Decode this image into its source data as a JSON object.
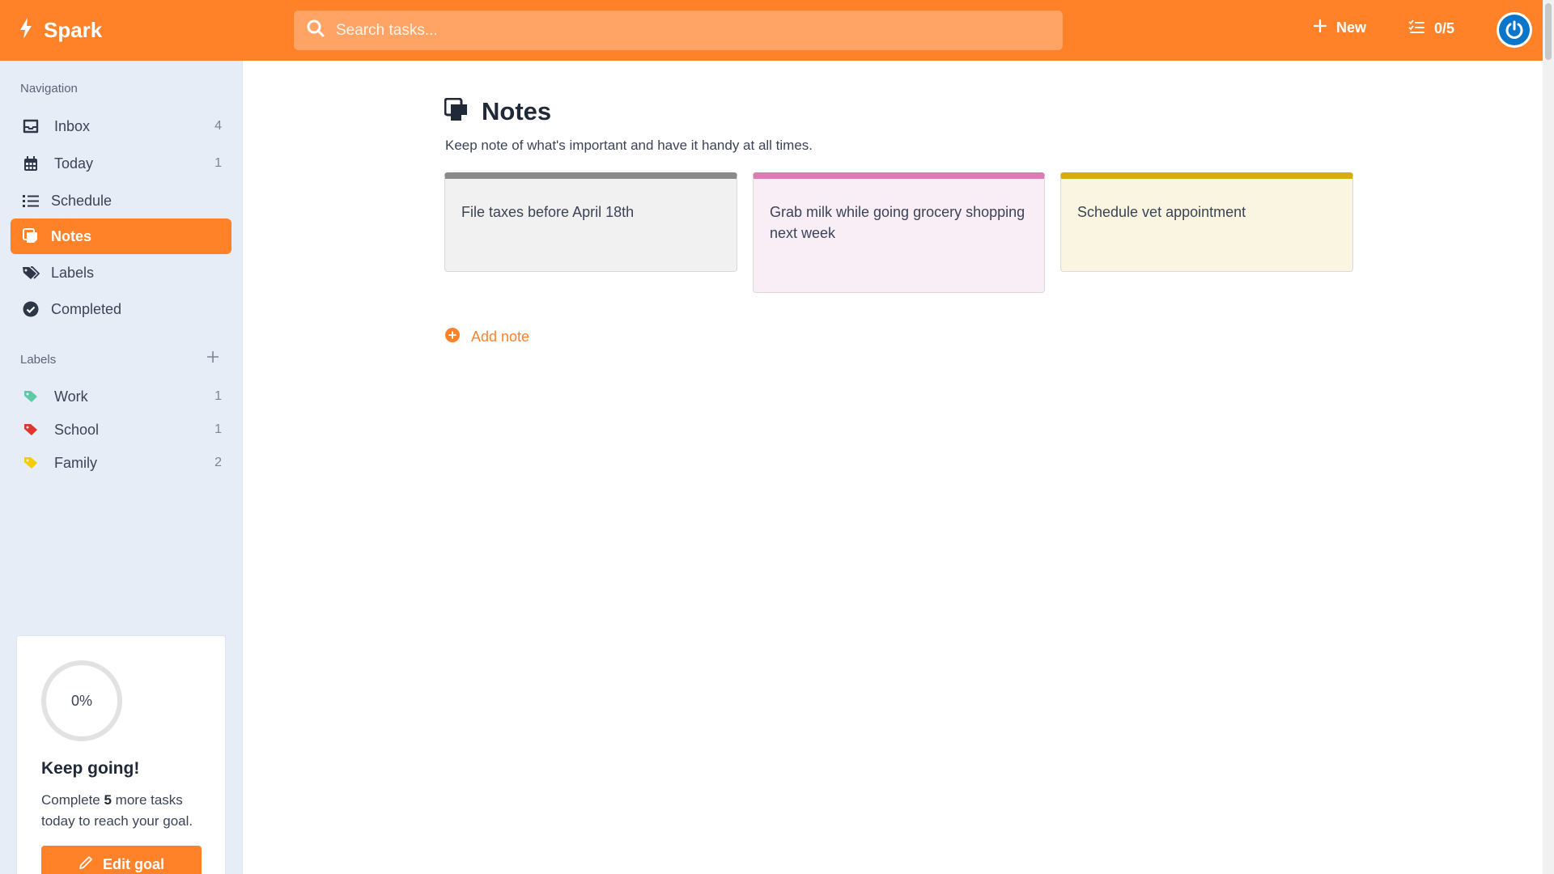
{
  "header": {
    "brand": "Spark",
    "search_placeholder": "Search tasks...",
    "new_label": "New",
    "progress_counter": "0/5",
    "accent_color": "#ff8229"
  },
  "sidebar": {
    "navigation_title": "Navigation",
    "nav_items": [
      {
        "label": "Inbox",
        "count": "4",
        "icon": "inbox-icon"
      },
      {
        "label": "Today",
        "count": "1",
        "icon": "calendar-icon"
      },
      {
        "label": "Schedule",
        "count": "",
        "icon": "list-icon"
      },
      {
        "label": "Notes",
        "count": "",
        "icon": "notes-icon",
        "active": true
      },
      {
        "label": "Labels",
        "count": "",
        "icon": "tags-icon"
      },
      {
        "label": "Completed",
        "count": "",
        "icon": "check-circle-icon"
      }
    ],
    "labels_title": "Labels",
    "labels": [
      {
        "label": "Work",
        "count": "1",
        "color": "#5cc9a7"
      },
      {
        "label": "School",
        "count": "1",
        "color": "#e0352b"
      },
      {
        "label": "Family",
        "count": "2",
        "color": "#f5cc00"
      }
    ],
    "goal": {
      "percent": "0%",
      "progress_fraction": 0,
      "title": "Keep going!",
      "text_before": "Complete ",
      "remaining": "5",
      "text_after": " more tasks today to reach your goal.",
      "button_label": "Edit goal"
    }
  },
  "main": {
    "title": "Notes",
    "subtitle": "Keep note of what's important and have it handy at all times.",
    "notes": [
      {
        "text": "File taxes before April 18th",
        "color": "#8a8a8a"
      },
      {
        "text": "Grab milk while going grocery shopping next week",
        "color": "#d77fb4"
      },
      {
        "text": "Schedule vet appointment",
        "color": "#d7ac0e"
      }
    ],
    "add_note_label": "Add note"
  }
}
